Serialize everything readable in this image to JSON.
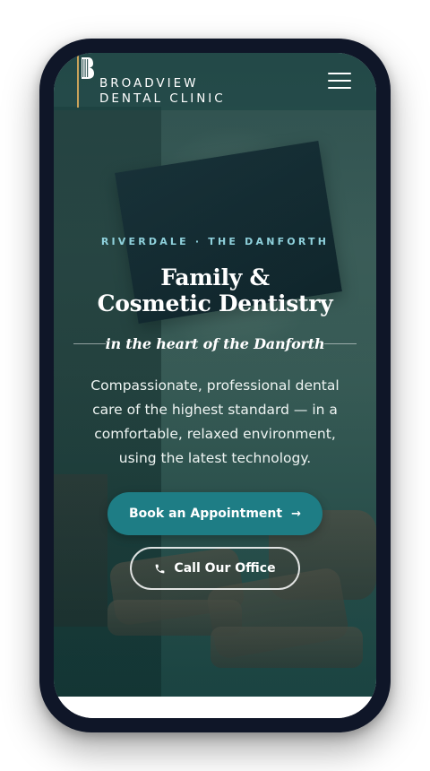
{
  "header": {
    "logo_line1": "BROADVIEW",
    "logo_line2": "DENTAL CLINIC",
    "menu_icon": "hamburger-menu-icon"
  },
  "hero": {
    "eyebrow": "RIVERDALE · THE DANFORTH",
    "title_line1": "Family &",
    "title_line2": "Cosmetic Dentistry",
    "tagline": "in the heart of the Danforth",
    "description": "Compassionate, professional dental care of the highest standard — in a comfortable, relaxed environment, using the latest technology.",
    "primary_button": {
      "label": "Book an Appointment",
      "icon": "arrow-right-icon"
    },
    "secondary_button": {
      "label": "Call Our Office",
      "icon": "phone-icon"
    }
  },
  "colors": {
    "accent": "#1e7d85",
    "eyebrow": "#8fd1dc",
    "frame": "#0f1628"
  }
}
